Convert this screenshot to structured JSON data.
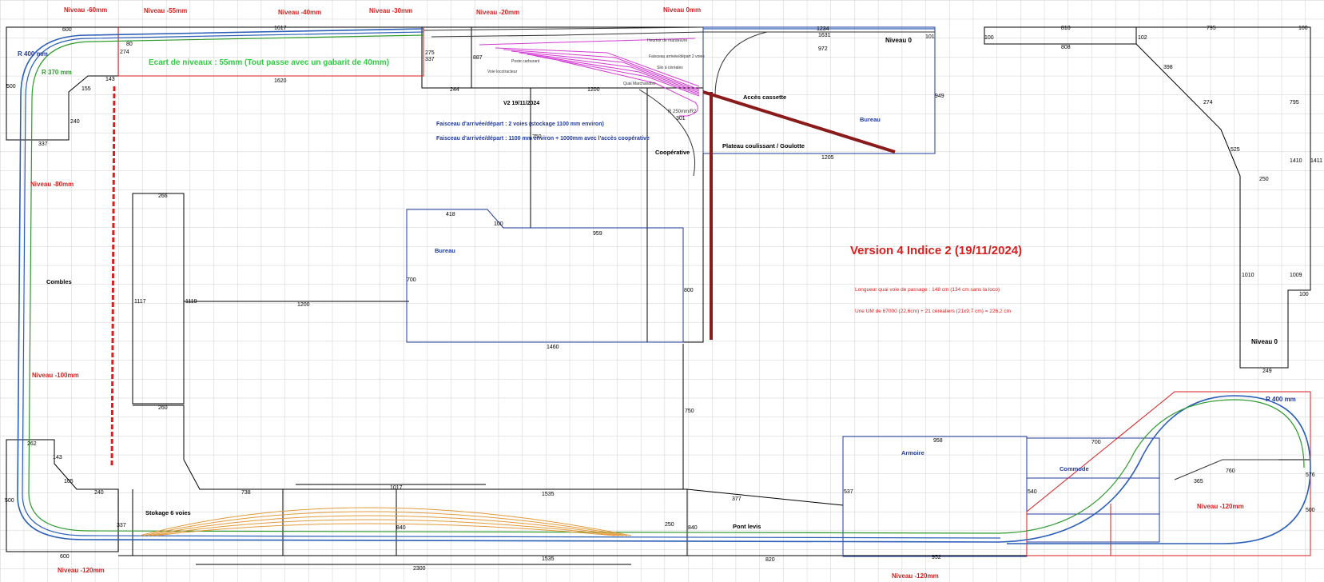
{
  "colors": {
    "grid": "#cfcfcf",
    "wall": "#000000",
    "blue": "#1f3a9e",
    "red": "#d81e1e",
    "green": "#2e9a2e",
    "track": "#2c5fb8",
    "pink": "#d43bd4",
    "orange": "#e39a3a",
    "maroon": "#8b1a1a"
  },
  "title": {
    "version": "Version 4  Indice 2  (19/11/2024)",
    "v2_note": "V2 19/11/2024"
  },
  "notes": {
    "ecart": "Ecart de niveaux : 55mm (Tout passe avec un gabarit de 40mm)",
    "faisceau1": "Faisceau d'arrivée/départ : 2 voies (stockage 1100 mm environ)",
    "faisceau2": "Faisceau d'arrivée/départ : 1100 mm environ + 1000mm avec l'accès coopérative",
    "longueur": "Longueur quai voie de passage : 148 cm (134 cm sans la loco)",
    "um": "Une UM de 67000 (22,6cm) + 21 céréaliers (21x9,7 cm) = 226,2 cm"
  },
  "levels": {
    "n60": "Niveau -60mm",
    "n55": "Niveau -55mm",
    "n40": "Niveau -40mm",
    "n30": "Niveau -30mm",
    "n20": "Niveau -20mm",
    "n0top": "Niveau 0mm",
    "n80": "Niveau -80mm",
    "n100": "Niveau -100mm",
    "n120a": "Niveau -120mm",
    "n120b": "Niveau -120mm",
    "n120c": "Niveau -120mm",
    "niv0a": "Niveau 0",
    "niv0b": "Niveau 0"
  },
  "radius": {
    "r400a": "R 400 mm",
    "r370": "R 370 mm",
    "r400b": "R 400 mm",
    "r250": "R 250mm/R2"
  },
  "rooms": {
    "bureau1": "Bureau",
    "bureau2": "Bureau",
    "combles": "Combles",
    "cooperative": "Coopérative",
    "acces": "Accès cassette",
    "plateau": "Plateau coulissant / Goulotte",
    "armoire": "Armoire",
    "commode": "Commode",
    "pontlevis": "Pont levis",
    "stockage": "Stokage 6 voies"
  },
  "station": {
    "poste": "Poste carburant",
    "voie": "Voie locotracteur",
    "quai": "Quai Marchandise",
    "heurtoir": "Heurtoir de manœuvre",
    "faisceau": "Faisceau arrivée/départ 2 voies",
    "cereales": "Silo à céréales"
  },
  "dims": {
    "d600a": "600",
    "d500a": "500",
    "d337a": "337",
    "d240a": "240",
    "d155": "155",
    "d143a": "143",
    "d80": "80",
    "d274": "274",
    "d1617": "1617",
    "d1620": "1620",
    "d275": "275",
    "d337b": "337",
    "d244": "244",
    "d887": "887",
    "d1200a": "1200",
    "d1234": "1234",
    "d1631": "1631",
    "d972": "972",
    "d101": "101",
    "d949": "949",
    "d1205": "1205",
    "d301": "301",
    "d750a": "750",
    "d750b": "750",
    "d418": "418",
    "d100a": "100",
    "d959": "959",
    "d700a": "700",
    "d800": "800",
    "d1460": "1460",
    "d1117": "1117",
    "d1119": "1119",
    "d1200b": "1200",
    "d266": "266",
    "d260": "260",
    "d262": "262",
    "d143b": "143",
    "d105": "105",
    "d240b": "240",
    "d500b": "500",
    "d337c": "337",
    "d600b": "600",
    "d738": "738",
    "d1017": "1017",
    "d1535a": "1535",
    "d840a": "840",
    "d250a": "250",
    "d840b": "840",
    "d377": "377",
    "d1535b": "1535",
    "d2300": "2300",
    "d820": "820",
    "d537": "537",
    "d958": "958",
    "d700b": "700",
    "d540": "540",
    "d952": "952",
    "d100b": "100",
    "d810": "810",
    "d795a": "795",
    "d100c": "100",
    "d808": "808",
    "d102": "102",
    "d398": "398",
    "d274b": "274",
    "d525": "525",
    "d795b": "795",
    "d1410": "1410",
    "d1411": "1411",
    "d250b": "250",
    "d1010": "1010",
    "d1009": "1009",
    "d100d": "100",
    "d249": "249",
    "d760": "760",
    "d365": "365",
    "d576": "576",
    "d500c": "500"
  }
}
